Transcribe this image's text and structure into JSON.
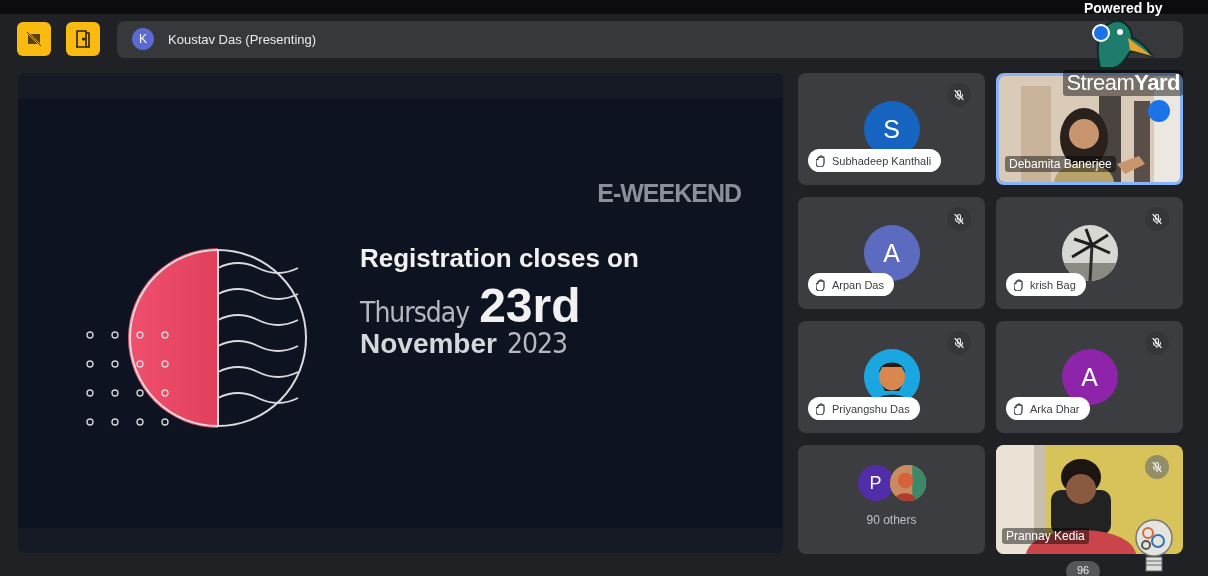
{
  "presenter": {
    "initial": "K",
    "label": "Koustav Das (Presenting)"
  },
  "slide": {
    "logo": "E-WEEKEND",
    "heading": "Registration closes on",
    "weekday": "Thursday",
    "day": "23rd",
    "month": "November",
    "year": "2023"
  },
  "tiles": [
    {
      "kind": "avatar",
      "initial": "S",
      "color": "#1565c0",
      "name": "Subhadeep Kanthali",
      "muted": true,
      "highlighted": false
    },
    {
      "kind": "video",
      "name": "Debamita Banerjee",
      "muted": false,
      "highlighted": true
    },
    {
      "kind": "avatar",
      "initial": "A",
      "color": "#5c6bc0",
      "name": "Arpan Das",
      "muted": true,
      "highlighted": false
    },
    {
      "name": "krish Bag",
      "muted": true,
      "highlighted": false
    },
    {
      "name": "Priyangshu Das",
      "muted": true,
      "highlighted": false
    },
    {
      "kind": "avatar",
      "initial": "A",
      "color": "#8e24aa",
      "name": "Arka Dhar",
      "muted": true,
      "highlighted": false
    },
    {
      "kind": "others",
      "initial": "P",
      "color": "#512da8",
      "label": "90 others"
    },
    {
      "kind": "video",
      "name": "Prannay Kedia",
      "muted": true,
      "highlighted": false
    }
  ],
  "overlay": {
    "powered_by": "Powered by",
    "brand_light": "Stream",
    "brand_bold": "Yard"
  },
  "viewer_count": "96"
}
